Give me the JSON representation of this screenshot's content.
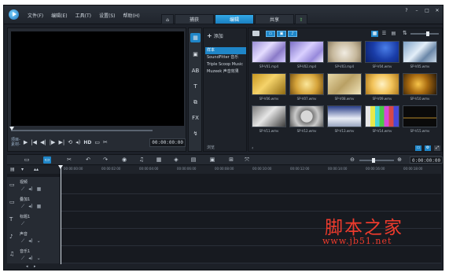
{
  "menu": [
    "文件(F)",
    "编辑(E)",
    "工具(T)",
    "设置(S)",
    "帮助(H)"
  ],
  "tabs": {
    "home": "⌂",
    "capture": "捕获",
    "edit": "编辑",
    "share": "共享",
    "extra": "⇧"
  },
  "window_controls": [
    "?",
    "–",
    "□",
    "✕"
  ],
  "player": {
    "mode_project": "项目-",
    "mode_clip": "素材-",
    "hd": "HD",
    "timecode": "00:00:00:00"
  },
  "library_sidebar": [
    "▦",
    "▣",
    "AB",
    "T",
    "⧉",
    "FX",
    "↯"
  ],
  "library": {
    "add_label": "添加",
    "items": [
      "样本",
      "SoundFitter 音乐",
      "Triple Scoop Music",
      "Muzeek 声音效果"
    ],
    "browse_label": "浏览"
  },
  "thumbnails": [
    {
      "caption": "SP-V01.mp4",
      "bg": "linear-gradient(135deg,#9b8fd6,#e4dcff 40%,#8a7ac8 70%,#d5cbff)"
    },
    {
      "caption": "SP-V02.mp4",
      "bg": "linear-gradient(135deg,#7d70c8,#d9d0ff 45%,#9789db 75%,#f0ecff)"
    },
    {
      "caption": "SP-V03.mp4",
      "bg": "radial-gradient(circle at 50% 55%,#f1ece2,#c6b89c 60%,#8e7e62)"
    },
    {
      "caption": "SP-V04.wmv",
      "bg": "radial-gradient(circle at 60% 30%,#4a7ee8,#1a3da8 50%,#0a1f6a)"
    },
    {
      "caption": "SP-V05.wmv",
      "bg": "linear-gradient(135deg,#7fa3c8,#e3eef8 45%,#6a87a8 70%,#c9d8e6)"
    },
    {
      "caption": "SP-V06.wmv",
      "bg": "linear-gradient(135deg,#c8961f,#f5d36a 45%,#8f6a12)"
    },
    {
      "caption": "SP-V07.wmv",
      "bg": "radial-gradient(circle at 50% 50%,#fbe79a,#d6a43a 55%,#7a5414)"
    },
    {
      "caption": "SP-V08.wmv",
      "bg": "linear-gradient(135deg,#e8d9a8,#b9a064 50%,#f0e4bb)"
    },
    {
      "caption": "SP-V09.wmv",
      "bg": "radial-gradient(circle at 50% 50%,#fff2c4,#f2c35a 50%,#b07a1c)"
    },
    {
      "caption": "SP-V10.wmv",
      "bg": "radial-gradient(circle at 45% 50%,#f7c44a,#a86a10 45%,#2a1a08)"
    },
    {
      "caption": "SP-V11.wmv",
      "bg": "linear-gradient(135deg,#7a7a7a,#e6e6e6 45%,#3c3c3c)"
    },
    {
      "caption": "SP-V12.wmv",
      "bg": "radial-gradient(circle at 50% 50%,#d8d8d8 30%,#7b7b7b 32%,#c9c9c9 60%,#5a5a5a)"
    },
    {
      "caption": "SP-V13.wmv",
      "bg": "linear-gradient(180deg,#2a3f88,#e9edf6 60%,#9aa6c0)"
    },
    {
      "caption": "SP-V14.wmv",
      "bg": "linear-gradient(90deg,#e8e8e8 0 14%,#e8e84a 14% 28%,#48d8d8 28% 42%,#48c848 42% 56%,#d848d8 56% 70%,#d84848 70% 84%,#4848d8 84%)"
    },
    {
      "caption": "SP-V15.wmv",
      "bg": "linear-gradient(180deg,#0a0a0a 0 55%,#b8892a 55% 60%,#0a0a0a 60%)"
    }
  ],
  "timeline": {
    "timecode": "0:00:00:00",
    "ruler_ticks": [
      "00:00:00:00",
      "00:00:02:00",
      "00:00:04:00",
      "00:00:06:00",
      "00:00:08:00",
      "00:00:10:00",
      "00:00:12:00",
      "00:00:14:00",
      "00:00:16:00",
      "00:00:18:00"
    ],
    "tracks": [
      {
        "icon": "▭",
        "name": "视频"
      },
      {
        "icon": "▭",
        "name": "叠加1"
      },
      {
        "icon": "T",
        "name": "标题1"
      },
      {
        "icon": "♪",
        "name": "声音"
      },
      {
        "icon": "♫",
        "name": "音乐1"
      }
    ]
  },
  "watermark": {
    "line1": "脚本之家",
    "line2": "www.jb51.net"
  },
  "colors": {
    "accent": "#1f86c8",
    "background": "#1d2129",
    "watermark": "#ef3b2d"
  }
}
